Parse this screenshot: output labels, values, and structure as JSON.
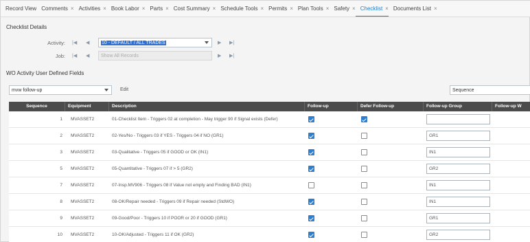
{
  "tabs": [
    {
      "label": "Record View",
      "closable": false
    },
    {
      "label": "Comments",
      "closable": true
    },
    {
      "label": "Activities",
      "closable": true
    },
    {
      "label": "Book Labor",
      "closable": true
    },
    {
      "label": "Parts",
      "closable": true
    },
    {
      "label": "Cost Summary",
      "closable": true
    },
    {
      "label": "Schedule Tools",
      "closable": true
    },
    {
      "label": "Permits",
      "closable": true
    },
    {
      "label": "Plan Tools",
      "closable": true
    },
    {
      "label": "Safety",
      "closable": true
    },
    {
      "label": "Checklist",
      "closable": true,
      "active": true
    },
    {
      "label": "Documents List",
      "closable": true
    }
  ],
  "close_glyph": "×",
  "checklist": {
    "title": "Checklist Details",
    "activity_label": "Activity:",
    "activity_value": "10 - DEFAULT / ALL TRADES",
    "job_label": "Job:",
    "job_value": "Show All Records",
    "nav": {
      "first": "|◀",
      "prev": "◀",
      "next": "▶",
      "last": "▶|"
    }
  },
  "udf": {
    "title": "WO Activity User Defined Fields",
    "filter_value": "mvw follow-up",
    "edit_label": "Edit",
    "sort_value": "Sequence"
  },
  "grid": {
    "columns": [
      "Sequence",
      "Equipment",
      "Description",
      "Follow-up",
      "Defer Follow-up",
      "Follow-up Group",
      "Follow-up W"
    ],
    "rows": [
      {
        "sequence": "1",
        "equipment": "MVASSET2",
        "description": "01-Checklist Item - Triggers 02 at completion - May trigger 90 if Signal exists (Defer)",
        "follow_up": true,
        "defer": true,
        "group": ""
      },
      {
        "sequence": "2",
        "equipment": "MVASSET2",
        "description": "02-Yes/No - Triggers 03 if YES - Triggers 04 if NO (GR1)",
        "follow_up": true,
        "defer": false,
        "group": "GR1"
      },
      {
        "sequence": "3",
        "equipment": "MVASSET2",
        "description": "03-Qualitative - Triggers 05 if GOOD or OK (IN1)",
        "follow_up": true,
        "defer": false,
        "group": "IN1"
      },
      {
        "sequence": "5",
        "equipment": "MVASSET2",
        "description": "05-Quantitative - Triggers 07 if > 5 (GR2)",
        "follow_up": true,
        "defer": false,
        "group": "GR2"
      },
      {
        "sequence": "7",
        "equipment": "MVASSET2",
        "description": "07-Insp.MV906 - Triggers 08 if Value not empty and Finding BAD (IN1)",
        "follow_up": false,
        "defer": false,
        "group": "IN1"
      },
      {
        "sequence": "8",
        "equipment": "MVASSET2",
        "description": "08-OK/Repair needed - Triggers 09 if Repair needed (StdWO)",
        "follow_up": true,
        "defer": false,
        "group": "IN1"
      },
      {
        "sequence": "9",
        "equipment": "MVASSET2",
        "description": "09-Good/Poor - Triggers 10 if POOR or 20 if GOOD (GR1)",
        "follow_up": true,
        "defer": false,
        "group": "GR1"
      },
      {
        "sequence": "10",
        "equipment": "MVASSET2",
        "description": "10-OK/Adjusted - Triggers 11 if OK (GR2)",
        "follow_up": true,
        "defer": false,
        "group": "GR2"
      }
    ]
  },
  "colors": {
    "accent": "#1f7fc6",
    "header_bg": "#4b4b4b",
    "checkbox_checked": "#2f7ed0",
    "selection": "#2f6fcf"
  }
}
